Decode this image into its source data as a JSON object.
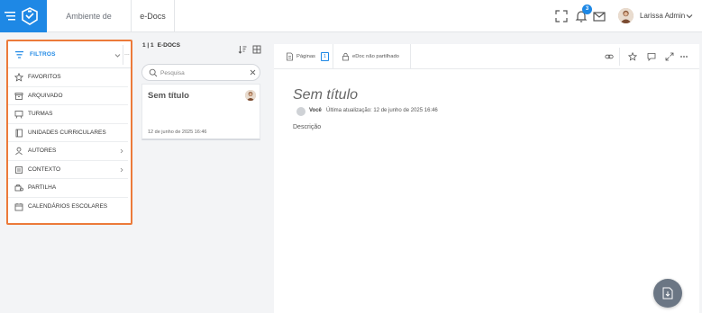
{
  "header": {
    "tabs": [
      "Ambiente de trabalho",
      "e-Docs"
    ],
    "notifications_count": "3",
    "user_name": "Larissa Admin"
  },
  "filters": {
    "title": "FILTROS",
    "more": "...",
    "items": [
      {
        "label": "FAVORITOS",
        "icon": "star-icon",
        "has_submenu": false
      },
      {
        "label": "ARQUIVADO",
        "icon": "archive-icon",
        "has_submenu": false
      },
      {
        "label": "TURMAS",
        "icon": "class-board-icon",
        "has_submenu": false
      },
      {
        "label": "UNIDADES CURRICULARES",
        "icon": "book-icon",
        "has_submenu": false
      },
      {
        "label": "AUTORES",
        "icon": "person-icon",
        "has_submenu": true
      },
      {
        "label": "CONTEXTO",
        "icon": "context-icon",
        "has_submenu": true
      },
      {
        "label": "PARTILHA",
        "icon": "share-icon",
        "has_submenu": false
      },
      {
        "label": "CALENDÁRIOS ESCOLARES",
        "icon": "calendar-icon",
        "has_submenu": false
      }
    ]
  },
  "docs": {
    "count": "1 | 1",
    "count_label": "E-DOCS",
    "search_placeholder": "Pesquisa",
    "cards": [
      {
        "title": "Sem título",
        "date": "12 de junho de 2025 16:46"
      }
    ]
  },
  "editor": {
    "pages_label": "Páginas",
    "pages_count": "1",
    "share_status": "eDoc não partilhado",
    "title": "Sem título",
    "author": "Você",
    "last_update": "Última atualização: 12 de junho de 2025 16:46",
    "description": "Descrição"
  },
  "colors": {
    "brand": "#1e88e5",
    "highlight": "#ec7a3a",
    "fab": "#6b7684"
  }
}
